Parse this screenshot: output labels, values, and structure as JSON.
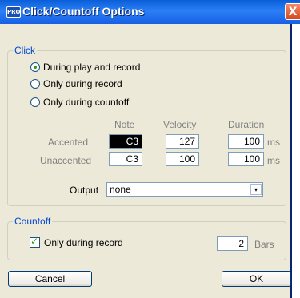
{
  "window": {
    "title": "Click/Countoff Options",
    "app_badge": "PRO",
    "close_glyph": "X"
  },
  "click": {
    "legend": "Click",
    "options": [
      "During play and record",
      "Only during record",
      "Only during countoff"
    ],
    "selected": 0,
    "headers": {
      "note": "Note",
      "velocity": "Velocity",
      "duration": "Duration"
    },
    "accented": {
      "label": "Accented",
      "note": "C3",
      "velocity": "127",
      "duration": "100",
      "unit": "ms"
    },
    "unaccented": {
      "label": "Unaccented",
      "note": "C3",
      "velocity": "100",
      "duration": "100",
      "unit": "ms"
    },
    "output": {
      "label": "Output",
      "value": "none"
    }
  },
  "countoff": {
    "legend": "Countoff",
    "checkbox_label": "Only during record",
    "checked": true,
    "bars_value": "2",
    "bars_label": "Bars"
  },
  "buttons": {
    "cancel": "Cancel",
    "ok": "OK"
  }
}
